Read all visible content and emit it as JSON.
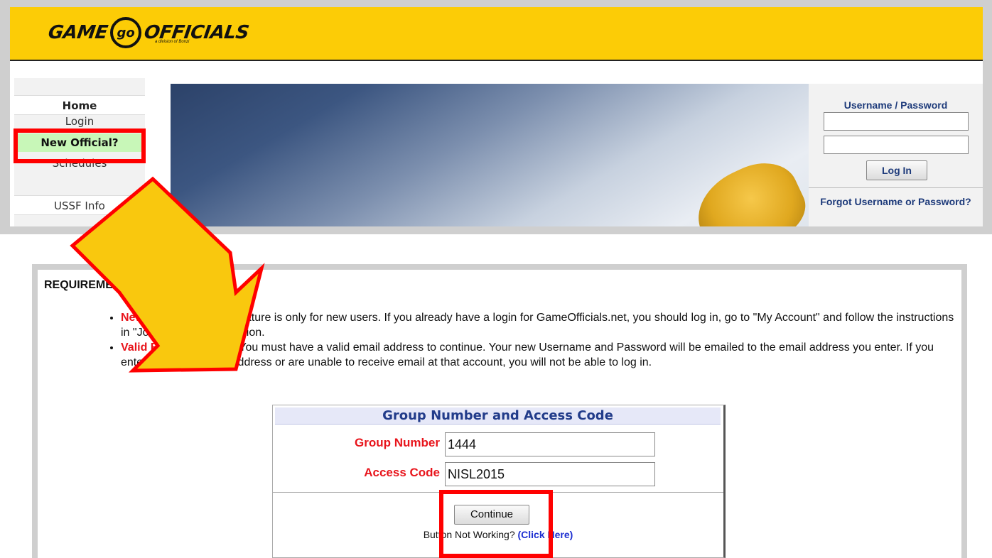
{
  "site": {
    "logo": {
      "word_left": "GAME",
      "circle_text": "go",
      "word_right": "OFFICIALS",
      "tagline": "a division of Bonzi"
    },
    "nav": {
      "home": "Home",
      "login": "Login",
      "new_official": "New Official?",
      "schedules": "Schedules",
      "ussf_info": "USSF Info"
    },
    "login_box": {
      "title": "Username / Password",
      "button": "Log In",
      "forgot": "Forgot Username or Password?"
    }
  },
  "requirements": {
    "heading": "REQUIREMENTS",
    "items": [
      {
        "term": "New User Only",
        "text": " - This feature is only for new users. If you already have a login for GameOfficials.net, you should log in, go to \"My Account\" and follow the instructions in \"Join New Group\" section."
      },
      {
        "term": "Valid Email Address",
        "text": " - You must have a valid email address to continue. Your new Username and Password will be emailed to the email address you enter. If you enter an invalid email address or are unable to receive email at that account, you will not be able to log in."
      }
    ]
  },
  "group_form": {
    "title": "Group Number and Access Code",
    "group_number_label": "Group Number",
    "group_number_value": "1444",
    "access_code_label": "Access Code",
    "access_code_value": "NISL2015",
    "continue_label": "Continue",
    "not_working_text": "Button Not Working? ",
    "click_here": "(Click Here)"
  },
  "colors": {
    "header_yellow": "#fccc06",
    "highlight_red": "#ff0000",
    "arrow_yellow": "#f9c80e",
    "new_official_green": "#c8f7b8",
    "link_blue": "#1d3a7a",
    "label_red": "#e8141b"
  }
}
